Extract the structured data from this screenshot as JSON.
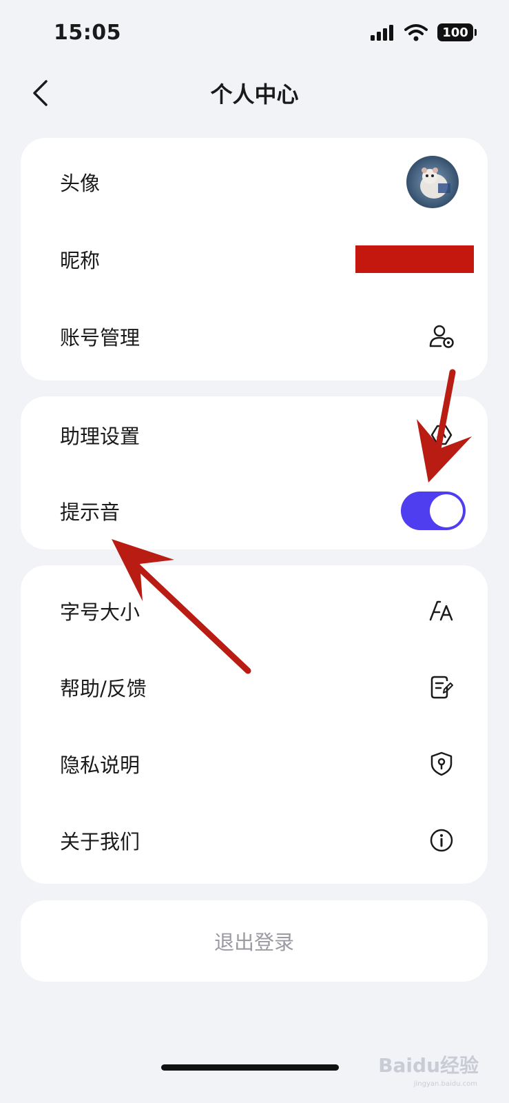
{
  "status_bar": {
    "time": "15:05",
    "battery": "100"
  },
  "nav": {
    "title": "个人中心"
  },
  "group1": {
    "avatar_label": "头像",
    "nickname_label": "昵称",
    "account_label": "账号管理"
  },
  "group2": {
    "assistant_label": "助理设置",
    "sound_label": "提示音",
    "sound_enabled": true
  },
  "group3": {
    "font_label": "字号大小",
    "help_label": "帮助/反馈",
    "privacy_label": "隐私说明",
    "about_label": "关于我们"
  },
  "logout": {
    "label": "退出登录"
  },
  "colors": {
    "accent": "#4f3df0",
    "annotation": "#b91c12",
    "background": "#f2f3f7"
  },
  "watermark": {
    "text": "Baidu经验",
    "url": "jingyan.baidu.com"
  }
}
